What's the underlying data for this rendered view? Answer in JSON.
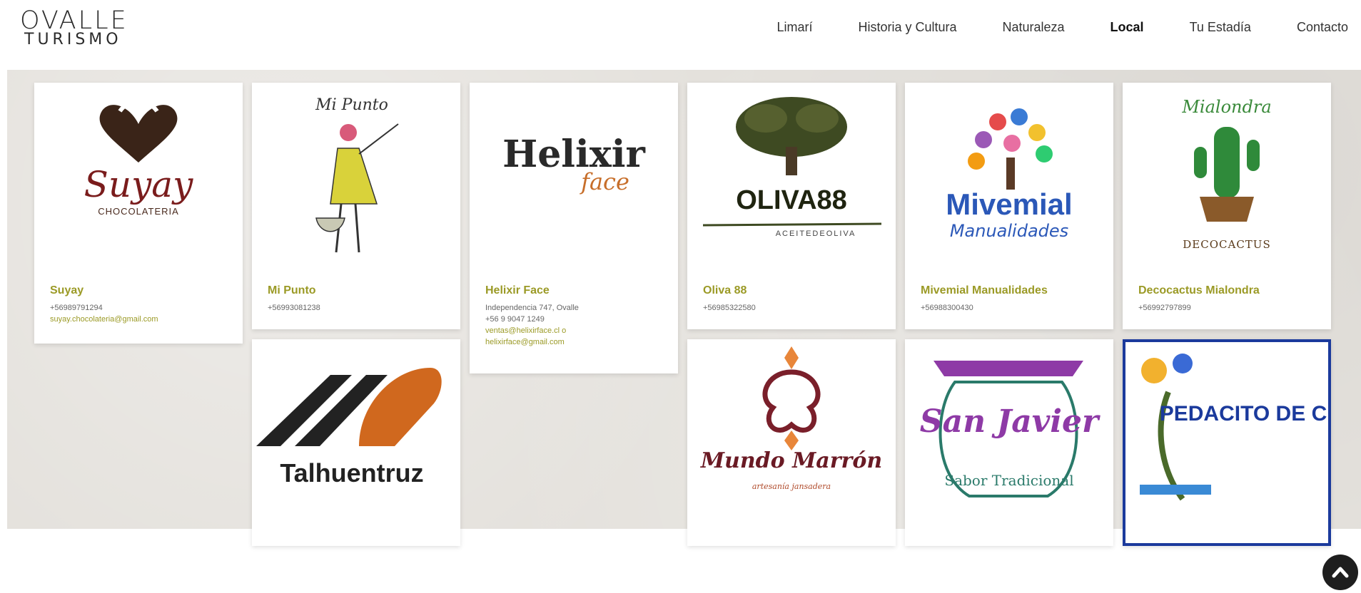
{
  "header": {
    "logo_line1": "OVALLE",
    "logo_line2": "TURISMO",
    "nav": [
      "Limarí",
      "Historia y Cultura",
      "Naturaleza",
      "Local",
      "Tu Estadía",
      "Contacto"
    ],
    "active_nav": "Local"
  },
  "cards": [
    {
      "name": "Suyay",
      "logo_text": "Suyay",
      "logo_sub": "CHOCOLATERIA",
      "lines": [
        "+56989791294"
      ],
      "links": [
        "suyay.chocolateria@gmail.com"
      ]
    },
    {
      "name": "Mi Punto",
      "logo_text": "Mi Punto",
      "lines": [
        "+56993081238"
      ],
      "links": []
    },
    {
      "name": "Helixir Face",
      "logo_text": "Helixir",
      "logo_sub": "face",
      "lines": [
        "Independencia 747, Ovalle",
        "+56 9 9047 1249"
      ],
      "links": [
        "ventas@helixirface.cl o",
        "helixirface@gmail.com"
      ]
    },
    {
      "name": "Oliva 88",
      "logo_text": "OLIVA88",
      "logo_sub": "ACEITEDEOLIVA",
      "lines": [
        "+56985322580"
      ],
      "links": []
    },
    {
      "name": "Mivemial Manualidades",
      "logo_text": "Mivemial",
      "logo_sub": "Manualidades",
      "lines": [
        "+56988300430"
      ],
      "links": []
    },
    {
      "name": "Decocactus Mialondra",
      "logo_text": "Mialondra",
      "logo_sub": "DECOCACTUS",
      "lines": [
        "+56992797899"
      ],
      "links": []
    },
    {
      "logo_text": "Talhuentruz"
    },
    {
      "logo_text": "Mundo Marrón",
      "logo_sub": "artesanía jansadera"
    },
    {
      "logo_text": "San Javier",
      "logo_sub": "Sabor Tradicional"
    },
    {
      "logo_text": "PEDACITO DE CIELO"
    }
  ]
}
